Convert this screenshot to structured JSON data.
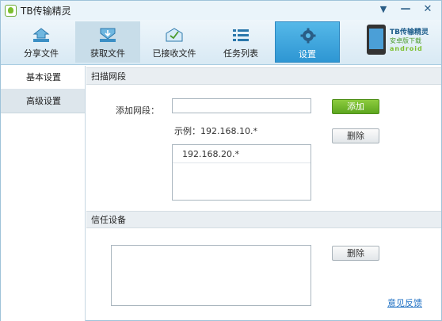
{
  "window": {
    "title": "TB传输精灵",
    "controls": {
      "menu": "▼",
      "minimize": "—",
      "close": "✕"
    }
  },
  "toolbar": {
    "items": [
      {
        "label": "分享文件",
        "icon": "share-file-icon",
        "state": "normal"
      },
      {
        "label": "获取文件",
        "icon": "download-file-icon",
        "state": "hover"
      },
      {
        "label": "已接收文件",
        "icon": "received-files-icon",
        "state": "normal"
      },
      {
        "label": "任务列表",
        "icon": "task-list-icon",
        "state": "normal"
      },
      {
        "label": "设置",
        "icon": "gear-icon",
        "state": "active"
      }
    ],
    "brand": {
      "line1": "TB传输精灵",
      "line2": "安卓版下载",
      "line3": "android"
    }
  },
  "sidebar": {
    "items": [
      {
        "label": "基本设置",
        "selected": false
      },
      {
        "label": "高级设置",
        "selected": true
      }
    ]
  },
  "scan": {
    "header": "扫描网段",
    "add_label": "添加网段：",
    "input_value": "",
    "example": "示例：192.168.10.*",
    "add_button": "添加",
    "delete_button": "删除",
    "segments": [
      "192.168.20.*"
    ]
  },
  "trusted": {
    "header": "信任设备",
    "delete_button": "删除",
    "devices": []
  },
  "footer": {
    "feedback_link": "意见反馈"
  },
  "colors": {
    "accent": "#2e96d3",
    "add_button": "#5da61f",
    "link": "#1d6fc3"
  }
}
